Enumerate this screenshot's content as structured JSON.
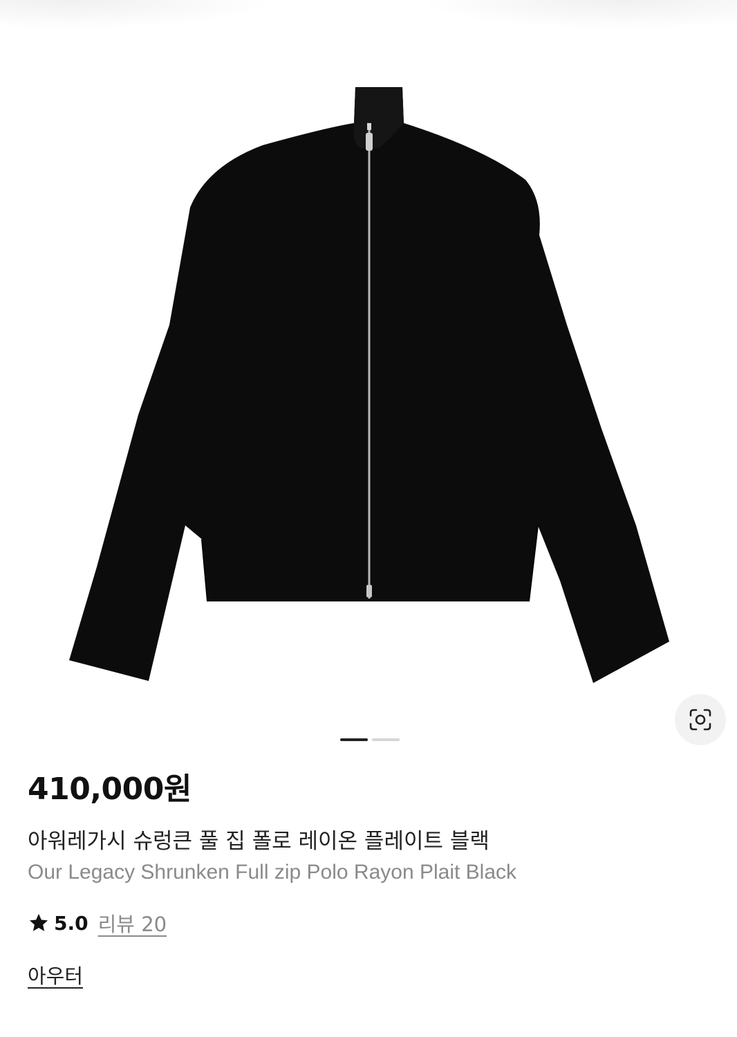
{
  "product": {
    "price": "410,000원",
    "name_ko": "아워레가시 슈렁큰 풀 집 폴로 레이온 플레이트 블랙",
    "name_en": "Our Legacy Shrunken Full zip Polo Rayon Plait Black",
    "rating": "5.0",
    "review_link": "리뷰 20",
    "category": "아우터"
  },
  "gallery": {
    "current_page": 1,
    "total_pages": 2,
    "lens_icon": "visual-search-icon"
  },
  "colors": {
    "garment": "#0c0c0c",
    "zipper": "#b8b8b8",
    "pager_active": "#222222",
    "pager_inactive": "#d6d6d6",
    "secondary_text": "#8a8a8a"
  }
}
